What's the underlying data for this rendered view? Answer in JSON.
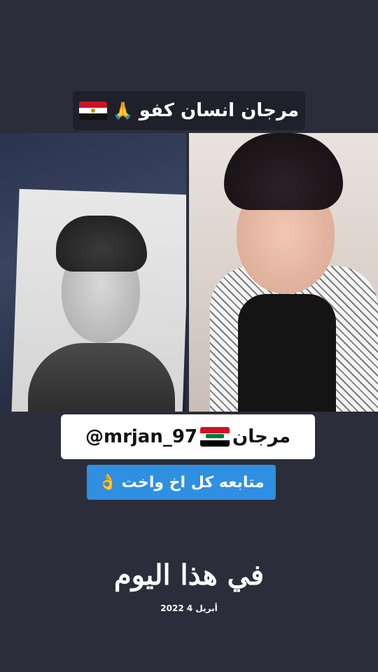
{
  "title": {
    "text": "مرجان انسان كفو",
    "emoji": "🙏"
  },
  "handle": {
    "name": "مرجان",
    "username": "@mrjan_97"
  },
  "follow": {
    "text": "متابعه كل اخ واخت",
    "emoji": "👌"
  },
  "watermark": {
    "brand": "في هذا اليوم",
    "date": "2022 أبريل 4"
  },
  "colors": {
    "background": "#2b2d3b",
    "follow_box": "#2f8fe0",
    "title_box": "#1f2029"
  }
}
